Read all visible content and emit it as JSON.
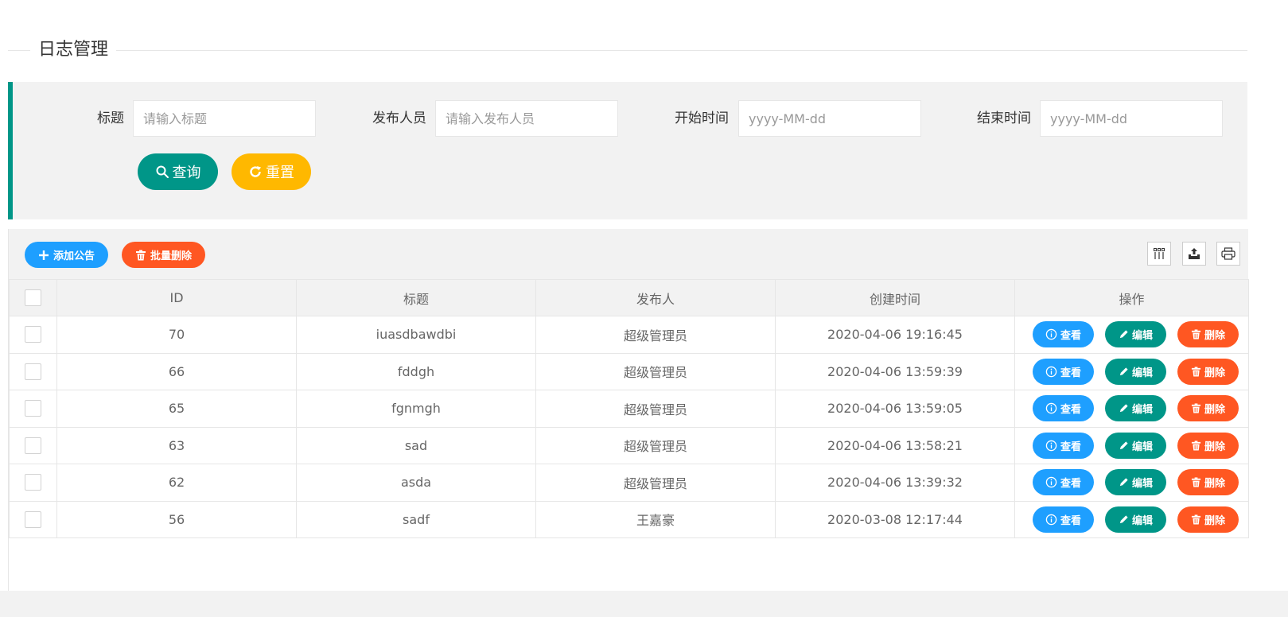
{
  "page": {
    "title": "日志管理"
  },
  "search": {
    "fields": [
      {
        "label": "标题",
        "placeholder": "请输入标题"
      },
      {
        "label": "发布人员",
        "placeholder": "请输入发布人员"
      },
      {
        "label": "开始时间",
        "placeholder": "yyyy-MM-dd"
      },
      {
        "label": "结束时间",
        "placeholder": "yyyy-MM-dd"
      }
    ],
    "query_label": "查询",
    "reset_label": "重置"
  },
  "toolbar": {
    "add_label": "添加公告",
    "batch_delete_label": "批量删除",
    "icons": [
      "columns-icon",
      "export-icon",
      "print-icon"
    ]
  },
  "table": {
    "headers": [
      "ID",
      "标题",
      "发布人",
      "创建时间",
      "操作"
    ],
    "rows": [
      {
        "id": "70",
        "title": "iuasdbawdbi",
        "publisher": "超级管理员",
        "created": "2020-04-06 19:16:45"
      },
      {
        "id": "66",
        "title": "fddgh",
        "publisher": "超级管理员",
        "created": "2020-04-06 13:59:39"
      },
      {
        "id": "65",
        "title": "fgnmgh",
        "publisher": "超级管理员",
        "created": "2020-04-06 13:59:05"
      },
      {
        "id": "63",
        "title": "sad",
        "publisher": "超级管理员",
        "created": "2020-04-06 13:58:21"
      },
      {
        "id": "62",
        "title": "asda",
        "publisher": "超级管理员",
        "created": "2020-04-06 13:39:32"
      },
      {
        "id": "56",
        "title": "sadf",
        "publisher": "王嘉豪",
        "created": "2020-03-08 12:17:44"
      }
    ],
    "actions": {
      "view": "查看",
      "edit": "编辑",
      "delete": "删除"
    }
  },
  "colors": {
    "primary": "#009688",
    "warm": "#ffb800",
    "normal": "#1e9fff",
    "danger": "#ff5722"
  }
}
